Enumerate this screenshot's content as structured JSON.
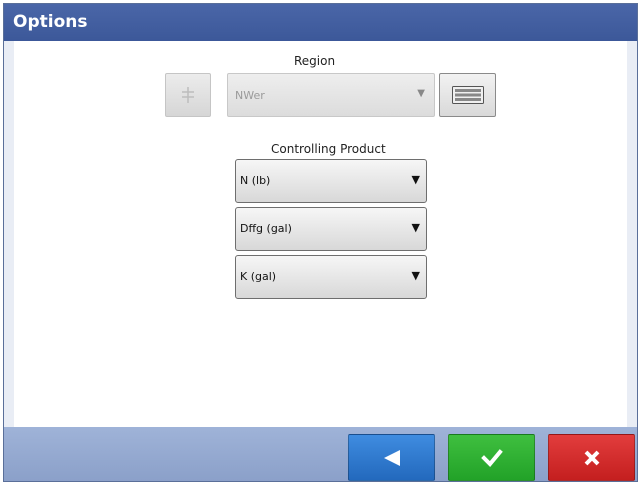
{
  "window": {
    "title": "Options"
  },
  "region": {
    "label": "Region",
    "selected": "NWer",
    "arrow": "▼",
    "filter_icon": "filter-icon",
    "keyboard_icon": "keyboard-icon"
  },
  "controlling_product": {
    "label": "Controlling Product",
    "arrow": "▼",
    "options": [
      {
        "value": "N (lb)"
      },
      {
        "value": "Dffg (gal)"
      },
      {
        "value": "K (gal)"
      }
    ]
  },
  "footer": {
    "back_icon": "left-arrow-icon",
    "ok_icon": "checkmark-icon",
    "cancel_icon": "x-icon"
  },
  "colors": {
    "titlebar": "#3f5c9e",
    "back": "#2f7fd6",
    "ok": "#2fb12f",
    "cancel": "#d42b2b"
  }
}
